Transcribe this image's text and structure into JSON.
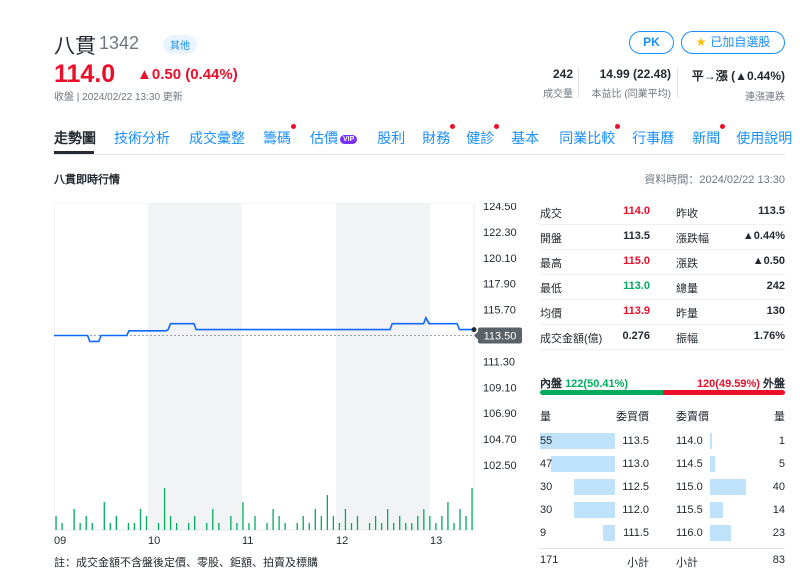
{
  "stock": {
    "name": "八貫",
    "code": "1342",
    "category": "其他",
    "price": "114.0",
    "change": "▲0.50 (0.44%)",
    "close_time": "收盤 | 2024/02/22 13:30 更新"
  },
  "actions": {
    "pk": "PK",
    "watchlist": "已加自選股"
  },
  "stats": [
    {
      "value": "242",
      "label": "成交量"
    },
    {
      "value": "14.99 (22.48)",
      "label": "本益比 (同業平均)"
    },
    {
      "value": "平→漲 (▲0.44%)",
      "label": "連漲連跌"
    }
  ],
  "tabs": [
    {
      "label": "走勢圖",
      "active": true,
      "dot": false,
      "vip": false
    },
    {
      "label": "技術分析",
      "dot": false
    },
    {
      "label": "成交彙整",
      "dot": false
    },
    {
      "label": "籌碼",
      "dot": true
    },
    {
      "label": "估價",
      "dot": false,
      "vip": true
    },
    {
      "label": "股利",
      "dot": false
    },
    {
      "label": "財務",
      "dot": true
    },
    {
      "label": "健診",
      "dot": true
    },
    {
      "label": "基本",
      "dot": false
    },
    {
      "label": "同業比較",
      "dot": true
    },
    {
      "label": "行事曆",
      "dot": false
    },
    {
      "label": "新聞",
      "dot": true
    },
    {
      "label": "使用說明",
      "dot": false
    }
  ],
  "vip_badge": "VIP",
  "section_title": "八貫即時行情",
  "data_time": "資料時間：2024/02/22 13:30",
  "chart_data": {
    "type": "line",
    "x_labels": [
      "09",
      "10",
      "11",
      "12",
      "13"
    ],
    "y_ticks": [
      "124.50",
      "122.30",
      "120.10",
      "117.90",
      "115.70",
      "113.50",
      "111.30",
      "109.10",
      "106.90",
      "104.70",
      "102.50"
    ],
    "ylim": [
      102.5,
      124.5
    ],
    "reference_price": 113.5,
    "current_label": "113.50",
    "price_series": [
      [
        0,
        113.5
      ],
      [
        30,
        113.5
      ],
      [
        32,
        113.0
      ],
      [
        40,
        113.0
      ],
      [
        42,
        113.5
      ],
      [
        65,
        113.5
      ],
      [
        67,
        113.9
      ],
      [
        100,
        113.9
      ],
      [
        102,
        114.0
      ],
      [
        104,
        114.5
      ],
      [
        125,
        114.5
      ],
      [
        127,
        114.0
      ],
      [
        300,
        114.0
      ],
      [
        302,
        114.5
      ],
      [
        330,
        114.5
      ],
      [
        332,
        115.0
      ],
      [
        335,
        114.5
      ],
      [
        360,
        114.5
      ],
      [
        362,
        114.0
      ],
      [
        375,
        114.0
      ]
    ],
    "volume_series": [
      2,
      1,
      0,
      3,
      1,
      2,
      1,
      0,
      4,
      1,
      2,
      0,
      1,
      1,
      3,
      2,
      0,
      1,
      6,
      2,
      1,
      0,
      1,
      2,
      0,
      1,
      3,
      1,
      0,
      2,
      1,
      4,
      1,
      2,
      0,
      1,
      3,
      2,
      1,
      0,
      1,
      2,
      1,
      3,
      2,
      5,
      2,
      1,
      3,
      1,
      2,
      0,
      1,
      2,
      1,
      3,
      1,
      2,
      1,
      1,
      2,
      3,
      2,
      1,
      2,
      4,
      1,
      3,
      2,
      6
    ],
    "grid": true
  },
  "quote": [
    {
      "l1": "成交",
      "v1": "114.0",
      "c1": "red",
      "l2": "昨收",
      "v2": "113.5",
      "c2": ""
    },
    {
      "l1": "開盤",
      "v1": "113.5",
      "c1": "",
      "l2": "漲跌幅",
      "v2": "▲0.44%",
      "c2": "red"
    },
    {
      "l1": "最高",
      "v1": "115.0",
      "c1": "red",
      "l2": "漲跌",
      "v2": "▲0.50",
      "c2": "red"
    },
    {
      "l1": "最低",
      "v1": "113.0",
      "c1": "green",
      "l2": "總量",
      "v2": "242",
      "c2": ""
    },
    {
      "l1": "均價",
      "v1": "113.9",
      "c1": "red",
      "l2": "昨量",
      "v2": "130",
      "c2": ""
    },
    {
      "l1": "成交金額(億)",
      "v1": "0.276",
      "c1": "",
      "l2": "振幅",
      "v2": "1.76%",
      "c2": ""
    }
  ],
  "inner": {
    "label": "內盤",
    "value": "122(50.41%)"
  },
  "outer": {
    "label": "外盤",
    "value": "120(49.59%)"
  },
  "orderbook": {
    "headers": {
      "bid_vol": "量",
      "bid_price": "委買價",
      "ask_price": "委賣價",
      "ask_vol": "量"
    },
    "bids": [
      {
        "vol": "55",
        "price": "113.5",
        "ratio": 1.0
      },
      {
        "vol": "47",
        "price": "113.0",
        "ratio": 0.85
      },
      {
        "vol": "30",
        "price": "112.5",
        "ratio": 0.55
      },
      {
        "vol": "30",
        "price": "112.0",
        "ratio": 0.55
      },
      {
        "vol": "9",
        "price": "111.5",
        "ratio": 0.16
      }
    ],
    "asks": [
      {
        "vol": "1",
        "price": "114.0",
        "ratio": 0.02
      },
      {
        "vol": "5",
        "price": "114.5",
        "ratio": 0.06
      },
      {
        "vol": "40",
        "price": "115.0",
        "ratio": 0.48
      },
      {
        "vol": "14",
        "price": "115.5",
        "ratio": 0.17
      },
      {
        "vol": "23",
        "price": "116.0",
        "ratio": 0.28
      }
    ],
    "bid_total": "171",
    "ask_total": "83",
    "subtotal_label": "小計"
  },
  "note": "註：成交金額不含盤後定價、零股、鉅額、拍賣及標購"
}
